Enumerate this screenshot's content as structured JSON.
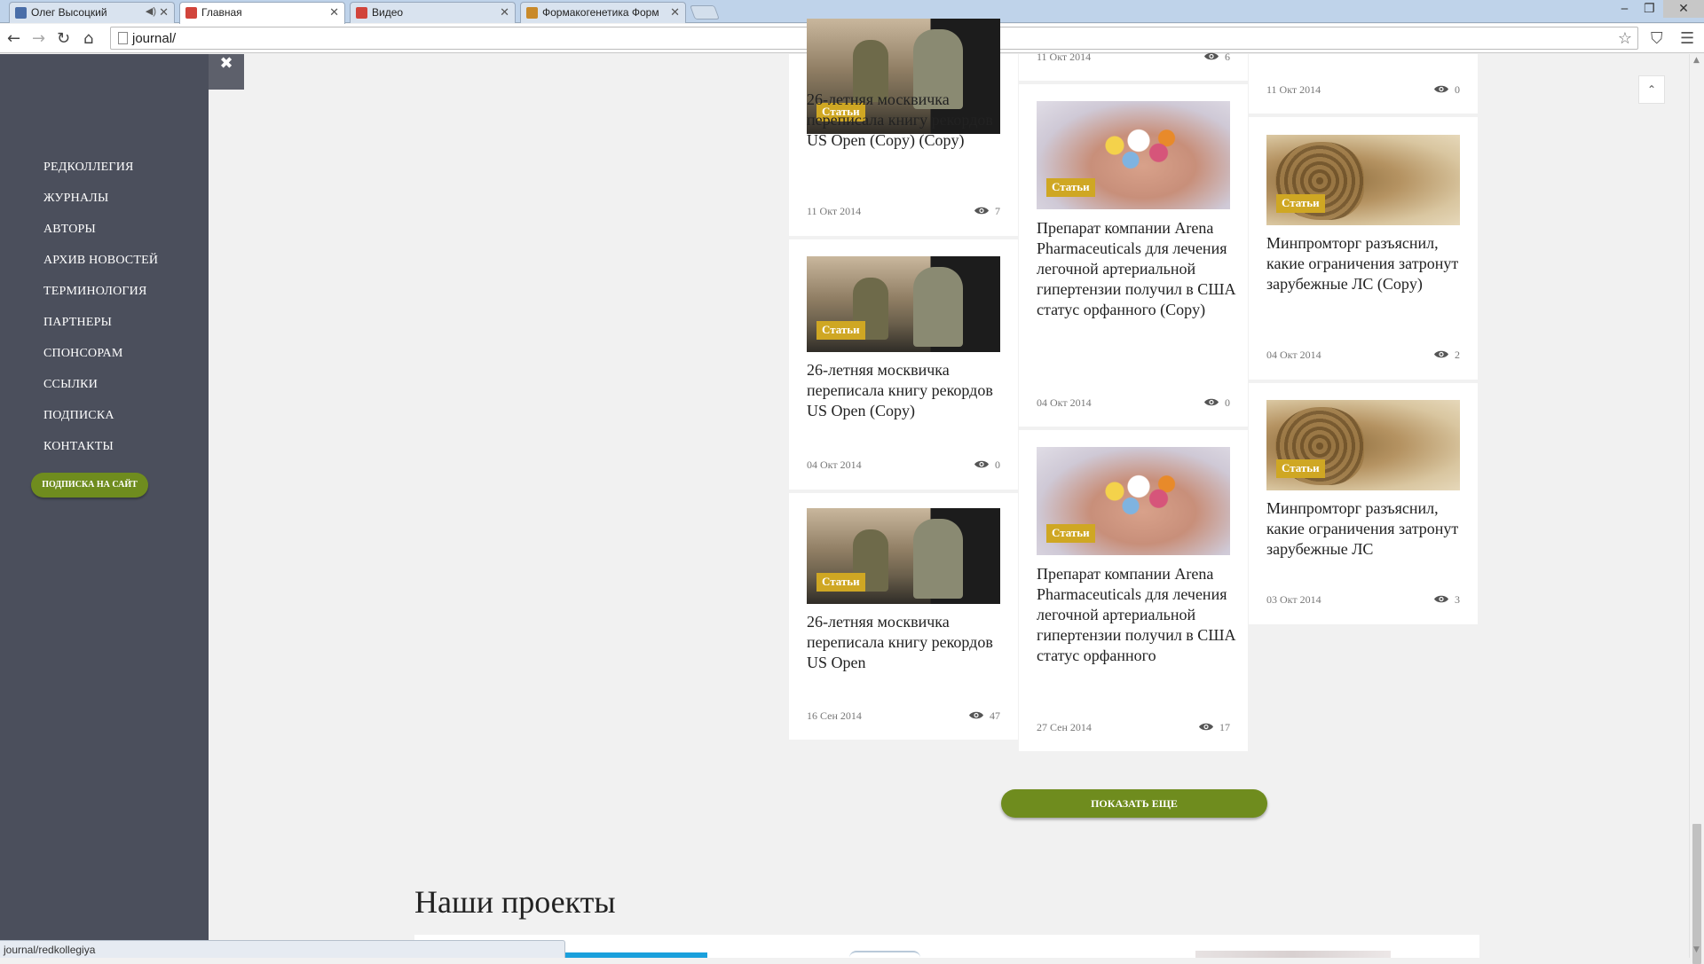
{
  "browser": {
    "tabs": [
      {
        "label": "Олег Высоцкий",
        "fav_color": "#4a6ea8"
      },
      {
        "label": "Главная",
        "fav_color": "#d1443b"
      },
      {
        "label": "Видео",
        "fav_color": "#d1443b"
      },
      {
        "label": "Формакогенетика Форм",
        "fav_color": "#c98a2a"
      }
    ],
    "url": "journal/",
    "status_url": "journal/redkollegiya",
    "close_symbol": "✕",
    "minimize_symbol": "‒",
    "restore_symbol": "❐"
  },
  "sidebar": {
    "close_symbol": "✖",
    "items": [
      "РЕДКОЛЛЕГИЯ",
      "ЖУРНАЛЫ",
      "АВТОРЫ",
      "АРХИВ НОВОСТЕЙ",
      "ТЕРМИНОЛОГИЯ",
      "ПАРТНЕРЫ",
      "СПОНСОРАМ",
      "ССЫЛКИ",
      "ПОДПИСКА",
      "КОНТАКТЫ"
    ],
    "subscribe_button": "ПОДПИСКА НА САЙТ"
  },
  "cards": {
    "c1": {
      "badge": "Статьи",
      "title": "26-летняя москвичка переписала книгу рекордов US Open (Copy) (Copy)",
      "date": "11 Окт 2014",
      "views": "7"
    },
    "c2": {
      "badge": "Статьи",
      "title": "26-летняя москвичка переписала книгу рекордов US Open (Copy)",
      "date": "04 Окт 2014",
      "views": "0"
    },
    "c3": {
      "badge": "Статьи",
      "title": "26-летняя москвичка переписала книгу рекордов US Open",
      "date": "16 Сен 2014",
      "views": "47"
    },
    "c4": {
      "date": "11 Окт 2014",
      "views": "6"
    },
    "c5": {
      "badge": "Статьи",
      "title": "Препарат компании Arena Pharmaceuticals для лечения легочной артериальной гипертензии получил в США статус орфанного (Copy)",
      "date": "04 Окт 2014",
      "views": "0"
    },
    "c6": {
      "badge": "Статьи",
      "title": "Препарат компании Arena Pharmaceuticals для лечения легочной артериальной гипертензии получил в США статус орфанного",
      "date": "27 Сен 2014",
      "views": "17"
    },
    "c7": {
      "date": "11 Окт 2014",
      "views": "0"
    },
    "c8": {
      "badge": "Статьи",
      "title": "Минпромторг разъяснил, какие ограничения затронут зарубежные ЛС (Copy)",
      "date": "04 Окт 2014",
      "views": "2"
    },
    "c9": {
      "badge": "Статьи",
      "title": "Минпромторг разъяснил, какие ограничения затронут зарубежные ЛС",
      "date": "03 Окт 2014",
      "views": "3"
    }
  },
  "show_more": "ПОКАЗАТЬ ЕЩЕ",
  "projects_heading": "Наши проекты",
  "to_top_symbol": "⌃",
  "colors": {
    "accent_green": "#6f8c1e",
    "badge_gold": "#cfa723",
    "sidebar_bg": "#4b4f5c"
  }
}
